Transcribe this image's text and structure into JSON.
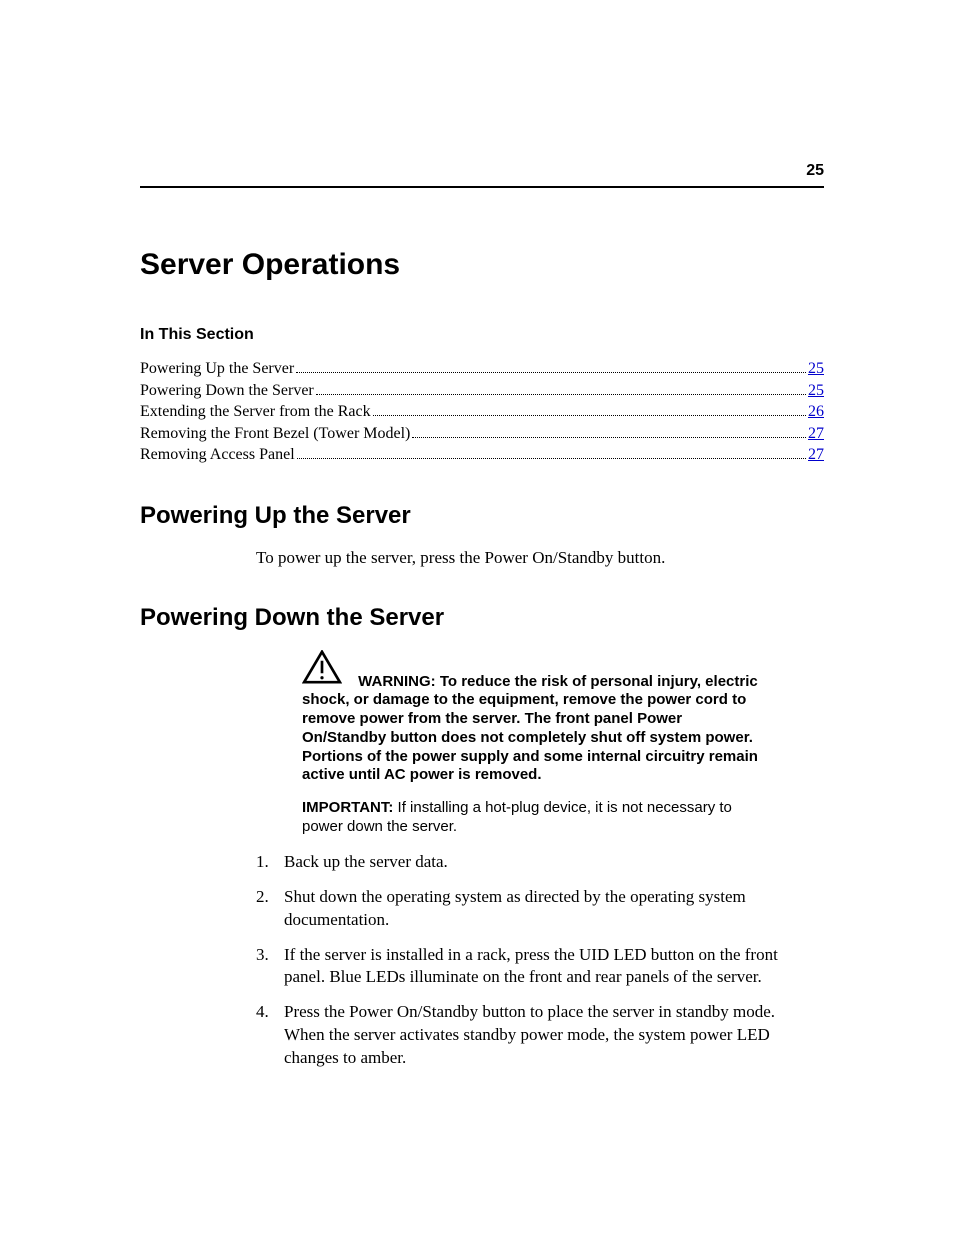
{
  "page_number": "25",
  "title": "Server Operations",
  "section_label": "In This Section",
  "toc": [
    {
      "title": "Powering Up the Server",
      "page": "25"
    },
    {
      "title": "Powering Down the Server",
      "page": "25"
    },
    {
      "title": "Extending the Server from the Rack",
      "page": "26"
    },
    {
      "title": "Removing the Front Bezel (Tower Model)",
      "page": "27"
    },
    {
      "title": "Removing Access Panel",
      "page": "27"
    }
  ],
  "section1": {
    "heading": "Powering Up the Server",
    "body": "To power up the server, press the Power On/Standby button."
  },
  "section2": {
    "heading": "Powering Down the Server",
    "warning_label": "WARNING:  ",
    "warning_text": "To reduce the risk of personal injury, electric shock, or damage to the equipment, remove the power cord to remove power from the server. The front panel Power On/Standby button does not completely shut off system power. Portions of the power supply and some internal circuitry remain active until AC power is removed.",
    "important_label": "IMPORTANT:  ",
    "important_text": "If installing a hot-plug device, it is not necessary to power down the server.",
    "steps": [
      "Back up the server data.",
      "Shut down the operating system as directed by the operating system documentation.",
      "If the server is installed in a rack, press the UID LED button on the front panel. Blue LEDs illuminate on the front and rear panels of the server.",
      "Press the Power On/Standby button to place the server in standby mode. When the server activates standby power mode, the system power LED changes to amber."
    ]
  }
}
